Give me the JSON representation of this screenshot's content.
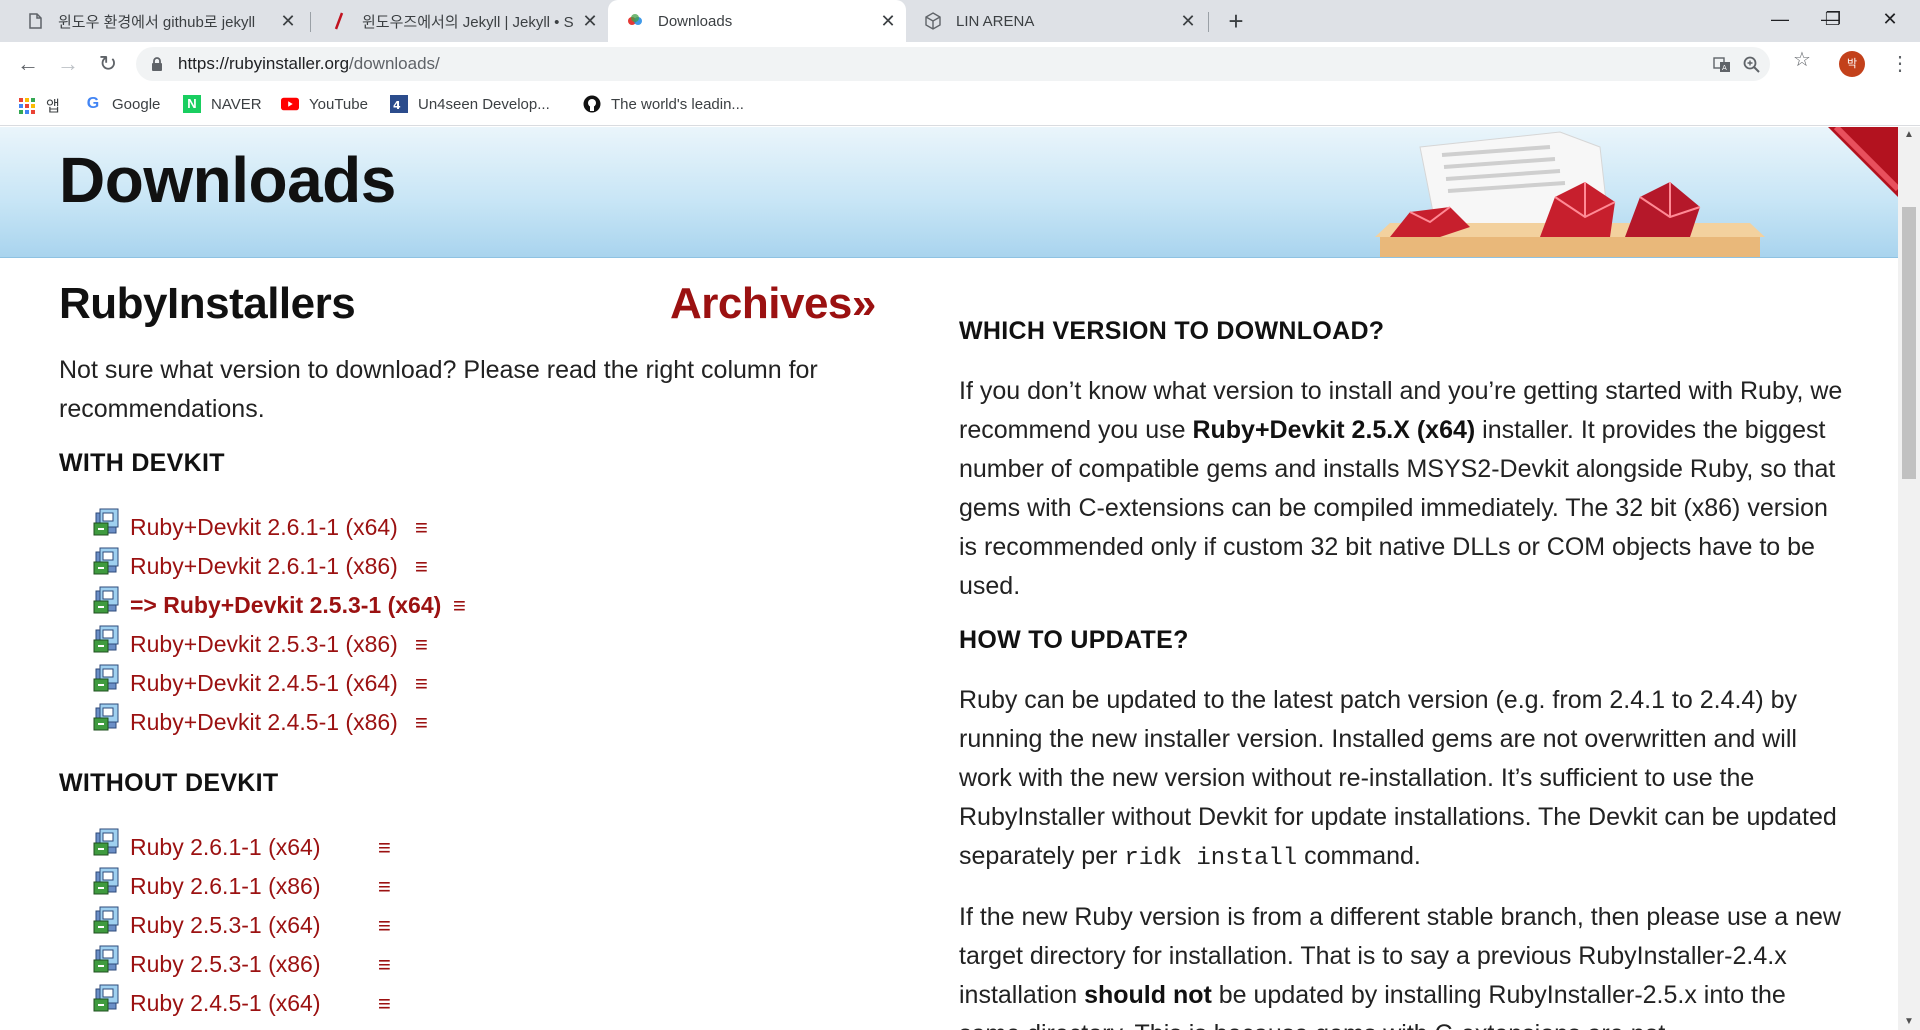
{
  "browser": {
    "tabs": [
      {
        "title": "윈도우 환경에서 github로 jekyll",
        "favicon": "document-icon",
        "active": false
      },
      {
        "title": "윈도우즈에서의 Jekyll | Jekyll • S",
        "favicon": "jekyll-icon",
        "active": false
      },
      {
        "title": "Downloads",
        "favicon": "rubyinstaller-icon",
        "active": true
      },
      {
        "title": "LIN ARENA",
        "favicon": "cube-icon",
        "active": false
      }
    ],
    "new_tab": "+",
    "window_controls": {
      "minimize": "—",
      "maximize": "❐",
      "close": "✕"
    },
    "url_host": "https://rubyinstaller.org",
    "url_path": "/downloads/",
    "avatar_letter": "박",
    "bookmarks": [
      {
        "label": "앱",
        "icon": "apps-grid-icon"
      },
      {
        "label": "Google",
        "icon": "google-icon"
      },
      {
        "label": "NAVER",
        "icon": "naver-icon"
      },
      {
        "label": "YouTube",
        "icon": "youtube-icon"
      },
      {
        "label": "Un4seen Develop...",
        "icon": "un4seen-icon"
      },
      {
        "label": "The world's leadin...",
        "icon": "github-icon"
      }
    ]
  },
  "page": {
    "hero_title": "Downloads",
    "left_title": "RubyInstallers",
    "archives_link": "Archives»",
    "intro": "Not sure what version to download? Please read the right column for recommendations.",
    "with_devkit_heading": "WITH DEVKIT",
    "with_devkit": [
      {
        "label": "Ruby+Devkit 2.6.1-1 (x64)",
        "hash": "≡",
        "recommended": false
      },
      {
        "label": "Ruby+Devkit 2.6.1-1 (x86)",
        "hash": "≡",
        "recommended": false
      },
      {
        "label": "=> Ruby+Devkit 2.5.3-1 (x64)",
        "hash": "≡",
        "recommended": true
      },
      {
        "label": "Ruby+Devkit 2.5.3-1 (x86)",
        "hash": "≡",
        "recommended": false
      },
      {
        "label": "Ruby+Devkit 2.4.5-1 (x64)",
        "hash": "≡",
        "recommended": false
      },
      {
        "label": "Ruby+Devkit 2.4.5-1 (x86)",
        "hash": "≡",
        "recommended": false
      }
    ],
    "without_devkit_heading": "WITHOUT DEVKIT",
    "without_devkit": [
      {
        "label": "Ruby 2.6.1-1 (x64)",
        "hash": "≡"
      },
      {
        "label": "Ruby 2.6.1-1 (x86)",
        "hash": "≡"
      },
      {
        "label": "Ruby 2.5.3-1 (x64)",
        "hash": "≡"
      },
      {
        "label": "Ruby 2.5.3-1 (x86)",
        "hash": "≡"
      },
      {
        "label": "Ruby 2.4.5-1 (x64)",
        "hash": "≡"
      }
    ],
    "right": {
      "which_heading": "WHICH VERSION TO DOWNLOAD?",
      "which_p1_a": "If you don’t know what version to install and you’re getting started with Ruby, we recommend you use ",
      "which_p1_bold": "Ruby+Devkit 2.5.X (x64)",
      "which_p1_b": " installer. It provides the biggest number of compatible gems and installs MSYS2-Devkit alongside Ruby, so that gems with C-extensions can be compiled immediately. The 32 bit (x86) version is recommended only if custom 32 bit native DLLs or COM objects have to be used.",
      "update_heading": "HOW TO UPDATE?",
      "update_p1_a": "Ruby can be updated to the latest patch version (e.g. from 2.4.1 to 2.4.4) by running the new installer version. Installed gems are not overwritten and will work with the new version without re-installation. It’s sufficient to use the RubyInstaller without Devkit for update installations. The Devkit can be updated separately per ",
      "update_p1_code": "ridk install",
      "update_p1_b": " command.",
      "update_p2_a": "If the new Ruby version is from a different stable branch, then please use a new target directory for installation. That is to say a previous RubyInstaller-2.4.x installation ",
      "update_p2_bold": "should not",
      "update_p2_b": " be updated by installing RubyInstaller-2.5.x into the same directory. This is because gems with C-extensions are not"
    }
  },
  "colors": {
    "link": "#9b1111",
    "hero_top": "#eaf5fb",
    "hero_bottom": "#a9d4ee"
  }
}
